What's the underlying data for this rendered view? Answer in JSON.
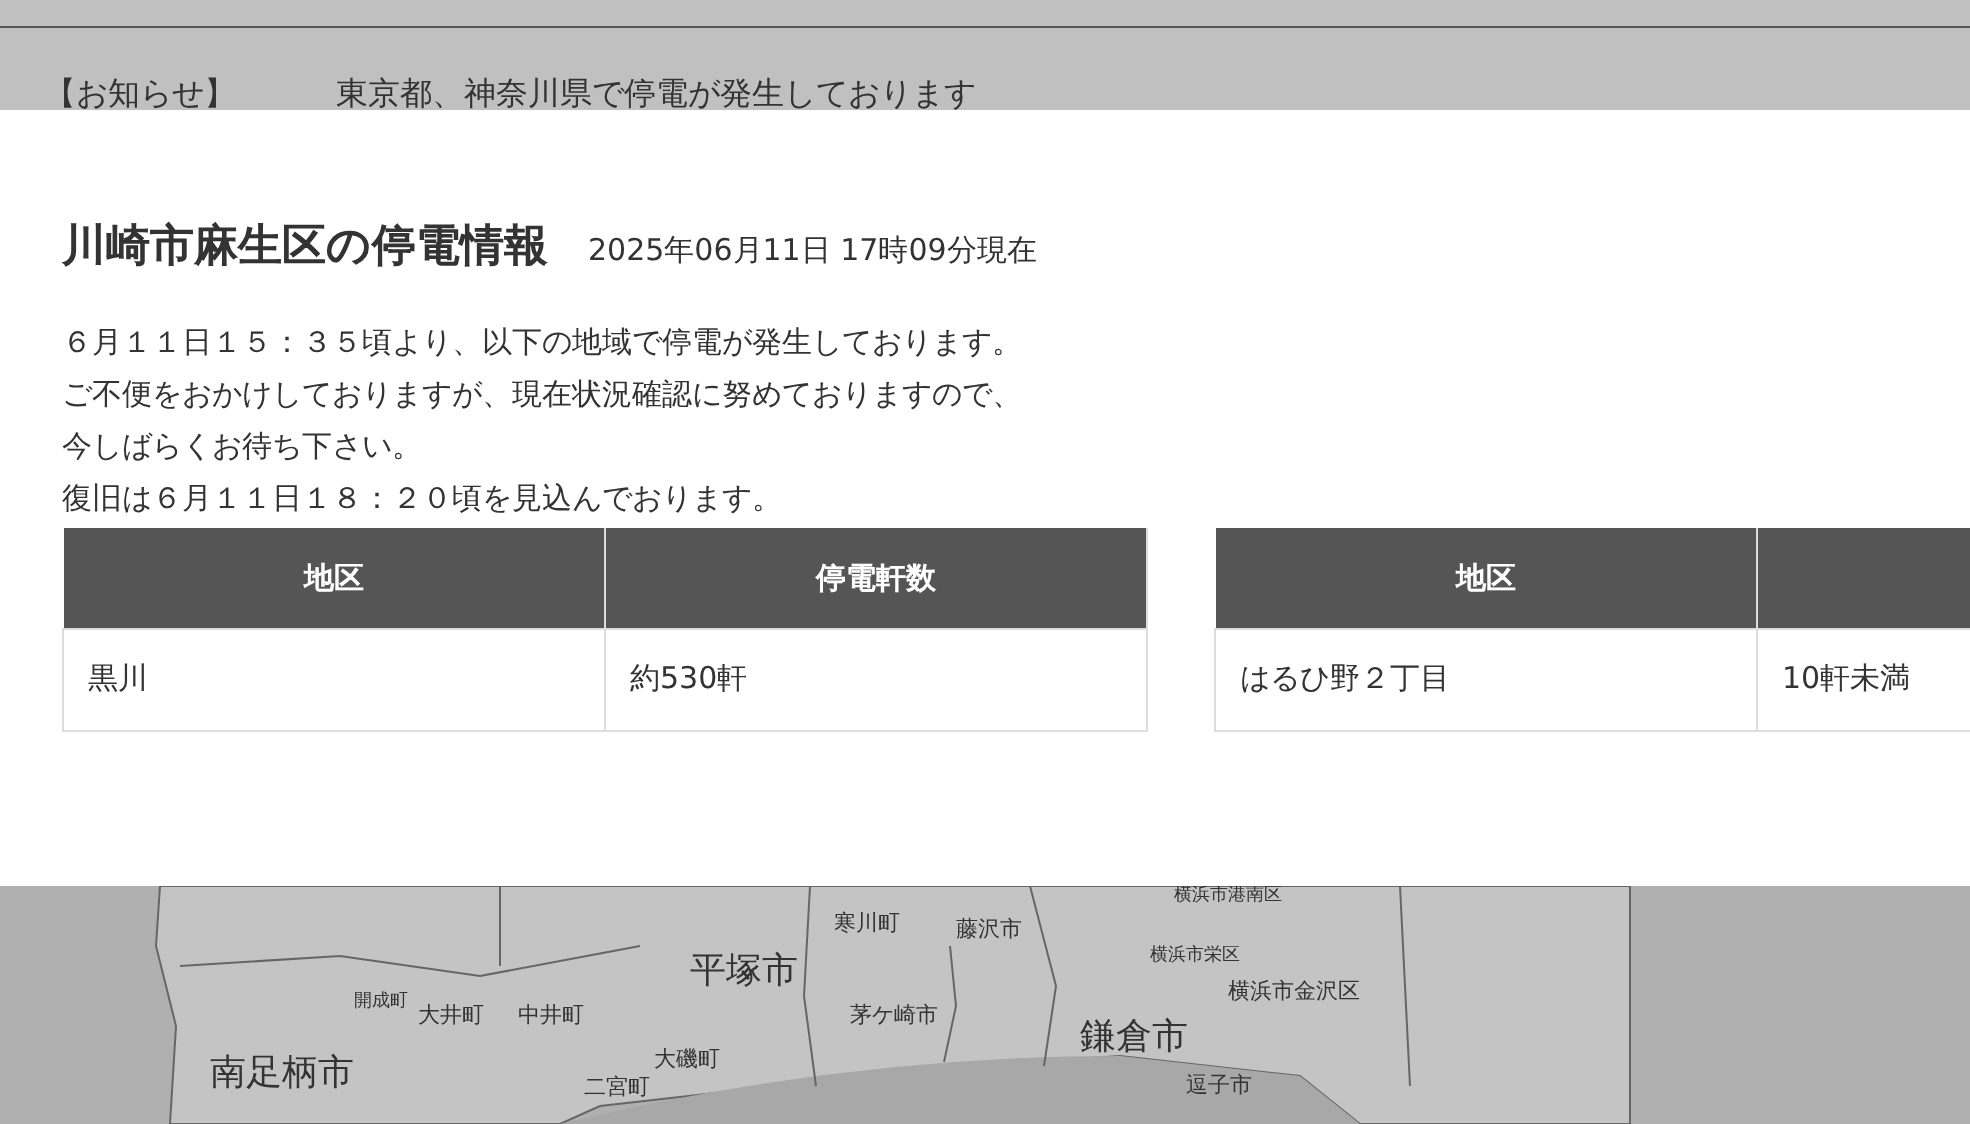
{
  "notice": {
    "label": "【お知らせ】",
    "text": "東京都、神奈川県で停電が発生しております"
  },
  "modal": {
    "title": "川崎市麻生区の停電情報",
    "timestamp": "2025年06月11日 17時09分現在",
    "message": [
      "６月１１日１５：３５頃より、以下の地域で停電が発生しております。",
      "ご不便をおかけしておりますが、現在状況確認に努めておりますので、",
      "今しばらくお待ち下さい。",
      "復旧は６月１１日１８：２０頃を見込んでおります。"
    ],
    "tables": [
      {
        "columns": [
          "地区",
          "停電軒数"
        ],
        "rows": [
          [
            "黒川",
            "約530軒"
          ]
        ]
      },
      {
        "columns": [
          "地区"
        ],
        "rows": [
          [
            "はるひ野２丁目",
            "10軒未満"
          ]
        ]
      }
    ]
  },
  "map": {
    "labels": [
      {
        "text": "寒川町",
        "kind": "minor"
      },
      {
        "text": "藤沢市",
        "kind": "minor"
      },
      {
        "text": "横浜市港南区",
        "kind": "ward"
      },
      {
        "text": "横浜市栄区",
        "kind": "ward"
      },
      {
        "text": "横浜市金沢区",
        "kind": "minor"
      },
      {
        "text": "平塚市",
        "kind": "major"
      },
      {
        "text": "開成町",
        "kind": "ward"
      },
      {
        "text": "大井町",
        "kind": "minor"
      },
      {
        "text": "中井町",
        "kind": "minor"
      },
      {
        "text": "茅ケ崎市",
        "kind": "minor"
      },
      {
        "text": "鎌倉市",
        "kind": "major"
      },
      {
        "text": "南足柄市",
        "kind": "major"
      },
      {
        "text": "大磯町",
        "kind": "minor"
      },
      {
        "text": "二宮町",
        "kind": "minor"
      },
      {
        "text": "逗子市",
        "kind": "minor"
      }
    ]
  }
}
